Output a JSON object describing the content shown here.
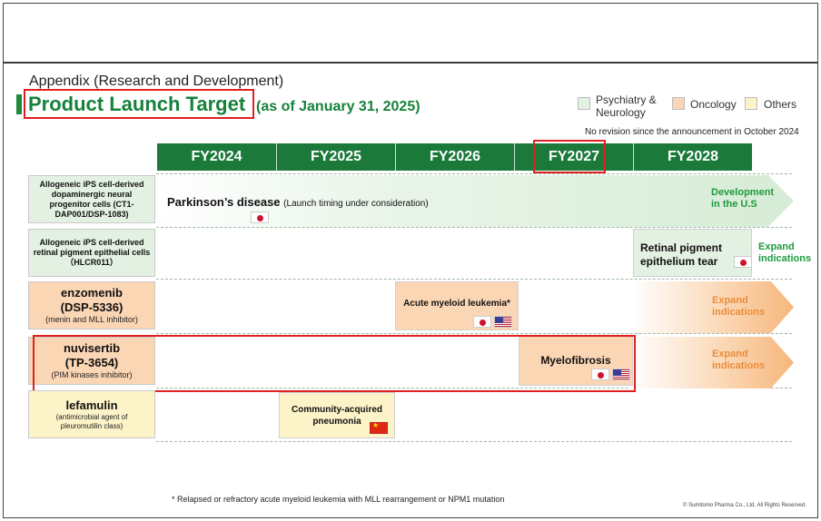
{
  "header": {
    "section": "Appendix (Research and Development)",
    "title": "Product Launch Target",
    "subtitle": "(as of January 31, 2025)",
    "note": "No revision since the announcement in October 2024"
  },
  "legend": [
    {
      "label": "Psychiatry &\nNeurology",
      "color": "#e3f1e3"
    },
    {
      "label": "Oncology",
      "color": "#fbd6b5"
    },
    {
      "label": "Others",
      "color": "#fdf3c8"
    }
  ],
  "years": [
    "FY2024",
    "FY2025",
    "FY2026",
    "FY2027",
    "FY2028"
  ],
  "rows": {
    "r1": {
      "drug_name": "Allogeneic iPS cell-derived dopaminergic neural progenitor cells (CT1-DAP001/DSP-1083)",
      "indication": "Parkinson’s disease",
      "indication_note": "(Launch timing under consideration)",
      "expand": "Development in the U.S"
    },
    "r2": {
      "drug_name": "Allogeneic iPS cell-derived retinal pigment epithelial cells（HLCR011）",
      "indication": "Retinal pigment epithelium tear",
      "expand": "Expand indications"
    },
    "r3": {
      "drug_name": "enzomenib (DSP-5336)",
      "drug_desc": "(menin and MLL inhibitor)",
      "indication": "Acute myeloid leukemia*",
      "expand": "Expand indications"
    },
    "r4": {
      "drug_name": "nuvisertib (TP-3654)",
      "drug_desc": "(PIM kinases inhibitor)",
      "indication": "Myelofibrosis",
      "expand": "Expand indications"
    },
    "r5": {
      "drug_name": "lefamulin",
      "drug_desc": "(antimicrobial agent of pleuromutilin class)",
      "indication": "Community-acquired pneumonia"
    }
  },
  "flags": {
    "japan": "japan-flag-icon",
    "usa": "usa-flag-icon",
    "china": "china-flag-icon"
  },
  "colors": {
    "brand_green": "#1b7a3a",
    "highlight_red": "#e02020",
    "expand_orange": "#ea8c3a"
  },
  "footnote": "* Relapsed or refractory acute myeloid leukemia with MLL rearrangement or NPM1 mutation",
  "copyright": "© Sumitomo Pharma Co., Ltd. All Rights Reserved."
}
